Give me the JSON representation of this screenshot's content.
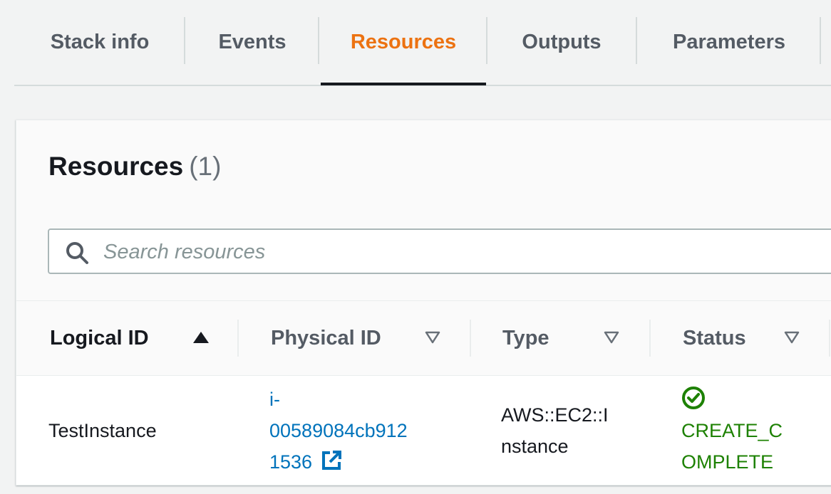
{
  "tabs": [
    {
      "label": "Stack info",
      "active": false
    },
    {
      "label": "Events",
      "active": false
    },
    {
      "label": "Resources",
      "active": true
    },
    {
      "label": "Outputs",
      "active": false
    },
    {
      "label": "Parameters",
      "active": false
    }
  ],
  "panel": {
    "title": "Resources",
    "count": "(1)",
    "search_placeholder": "Search resources"
  },
  "table": {
    "columns": [
      {
        "label": "Logical ID",
        "sort": "ascending"
      },
      {
        "label": "Physical ID",
        "sort": "none"
      },
      {
        "label": "Type",
        "sort": "none"
      },
      {
        "label": "Status",
        "sort": "none"
      }
    ],
    "rows": [
      {
        "logical_id": "TestInstance",
        "physical_id_lines": [
          "i-",
          "00589084cb912",
          "1536"
        ],
        "type_lines": [
          "AWS::EC2::I",
          "nstance"
        ],
        "status_lines": [
          "CREATE_C",
          "OMPLETE"
        ],
        "status_icon": "success-check-circle-icon"
      }
    ]
  },
  "colors": {
    "active_tab": "#ec7211",
    "link": "#0073bb",
    "success": "#1d8102"
  }
}
